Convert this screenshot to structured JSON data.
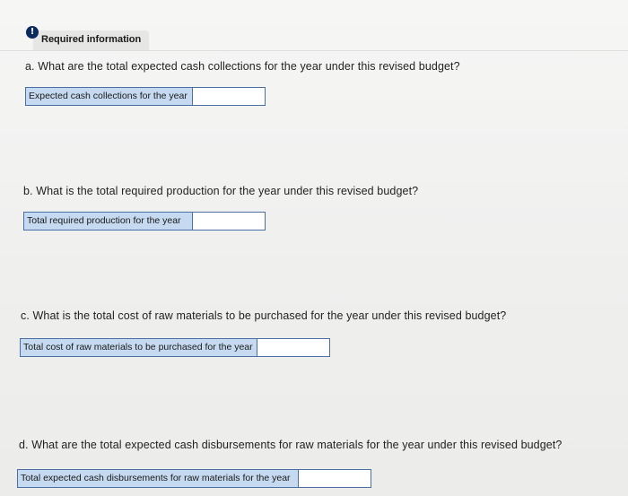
{
  "header": {
    "alert_glyph": "!",
    "title": "Required information"
  },
  "questions": [
    {
      "prompt": "a. What are the total expected cash collections for the year under this revised budget?",
      "answer_label": "Expected cash collections for the year",
      "answer_value": ""
    },
    {
      "prompt": "b. What is the total required production for the year under this revised budget?",
      "answer_label": "Total required production for the year",
      "answer_value": ""
    },
    {
      "prompt": "c. What is the total cost of raw materials to be purchased for the year under this revised budget?",
      "answer_label": "Total cost of raw materials to be purchased for the year",
      "answer_value": ""
    },
    {
      "prompt": "d. What are the total expected cash disbursements for raw materials for the year under this revised budget?",
      "answer_label": "Total expected cash disbursements for raw materials for the year",
      "answer_value": ""
    }
  ],
  "colors": {
    "alert_icon_bg": "#0b2a5e",
    "answer_label_bg": "#c5d9f0",
    "answer_border": "#4a6fa5"
  },
  "icons": {
    "alert": "exclamation-circle-icon"
  }
}
